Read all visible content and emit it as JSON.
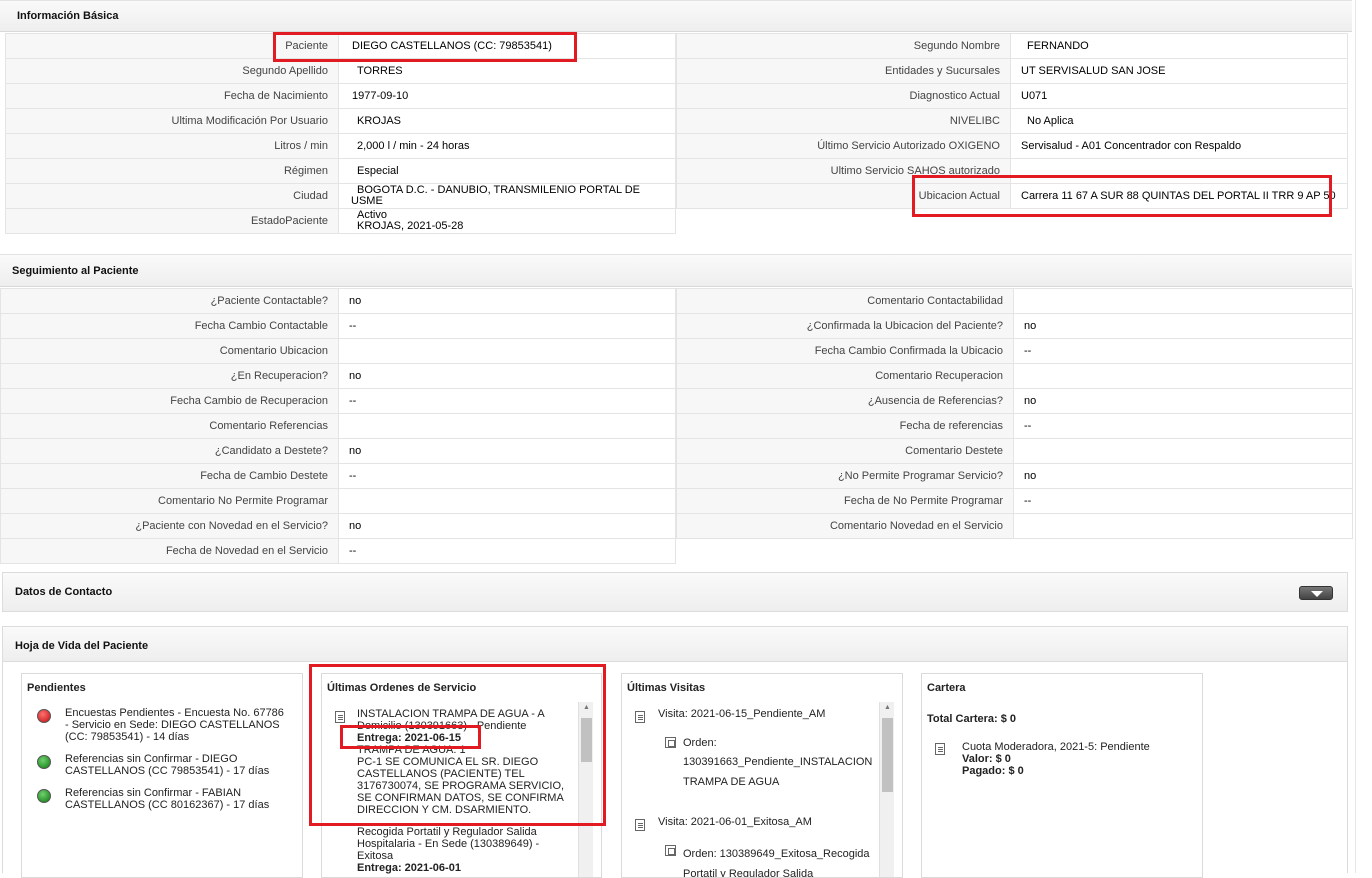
{
  "info": {
    "title": "Información Básica",
    "left": [
      {
        "label": "Paciente",
        "value": "DIEGO CASTELLANOS (CC: 79853541)"
      },
      {
        "label": "Segundo Apellido",
        "value": "TORRES"
      },
      {
        "label": "Fecha de Nacimiento",
        "value": "1977-09-10"
      },
      {
        "label": "Ultima Modificación Por Usuario",
        "value": "KROJAS"
      },
      {
        "label": "Litros / min",
        "value": "2,000 l / min - 24 horas"
      },
      {
        "label": "Régimen",
        "value": "Especial"
      },
      {
        "label": "Ciudad",
        "value": "BOGOTA D.C. - DANUBIO, TRANSMILENIO PORTAL DE USME"
      },
      {
        "label": "EstadoPaciente",
        "value": "Activo",
        "value2": "KROJAS, 2021-05-28"
      }
    ],
    "right": [
      {
        "label": "Segundo Nombre",
        "value": "FERNANDO"
      },
      {
        "label": "Entidades y Sucursales",
        "value": "UT SERVISALUD SAN JOSE"
      },
      {
        "label": "Diagnostico Actual",
        "value": "U071"
      },
      {
        "label": "NIVELIBC",
        "value": "No Aplica"
      },
      {
        "label": "Último Servicio Autorizado OXIGENO",
        "value": "Servisalud - A01 Concentrador con Respaldo"
      },
      {
        "label": "Ultimo Servicio SAHOS autorizado",
        "value": ""
      },
      {
        "label": "Ubicacion Actual",
        "value": "Carrera 11 67 A SUR 88 QUINTAS DEL PORTAL II TRR 9 AP 50"
      }
    ]
  },
  "seguimiento": {
    "title": "Seguimiento al Paciente",
    "left": [
      {
        "label": "¿Paciente Contactable?",
        "value": "no"
      },
      {
        "label": "Fecha Cambio Contactable",
        "value": "--"
      },
      {
        "label": "Comentario Ubicacion",
        "value": ""
      },
      {
        "label": "¿En Recuperacion?",
        "value": "no"
      },
      {
        "label": "Fecha Cambio de Recuperacion",
        "value": "--"
      },
      {
        "label": "Comentario Referencias",
        "value": ""
      },
      {
        "label": "¿Candidato a Destete?",
        "value": "no"
      },
      {
        "label": "Fecha de Cambio Destete",
        "value": "--"
      },
      {
        "label": "Comentario No Permite Programar",
        "value": ""
      },
      {
        "label": "¿Paciente con Novedad en el Servicio?",
        "value": "no"
      },
      {
        "label": "Fecha de Novedad en el Servicio",
        "value": "--"
      }
    ],
    "right": [
      {
        "label": "Comentario Contactabilidad",
        "value": ""
      },
      {
        "label": "¿Confirmada la Ubicacion del Paciente?",
        "value": "no"
      },
      {
        "label": "Fecha Cambio Confirmada la Ubicacio",
        "value": "--"
      },
      {
        "label": "Comentario Recuperacion",
        "value": ""
      },
      {
        "label": "¿Ausencia de Referencias?",
        "value": "no"
      },
      {
        "label": "Fecha de referencias",
        "value": "--"
      },
      {
        "label": "Comentario Destete",
        "value": ""
      },
      {
        "label": "¿No Permite Programar Servicio?",
        "value": "no"
      },
      {
        "label": "Fecha de No Permite Programar",
        "value": "--"
      },
      {
        "label": "Comentario Novedad en el Servicio",
        "value": ""
      }
    ]
  },
  "contacto": {
    "title": "Datos de Contacto",
    "toggle_icon": "chevron-down-icon"
  },
  "hoja": {
    "title": "Hoja de Vida del Paciente",
    "pendientes": {
      "title": "Pendientes",
      "items": [
        {
          "status": "red",
          "text": "Encuestas Pendientes - Encuesta No. 67786 - Servicio en Sede: DIEGO CASTELLANOS (CC: 79853541) - 14 días"
        },
        {
          "status": "green",
          "text": "Referencias sin Confirmar - DIEGO CASTELLANOS (CC 79853541) - 17 días"
        },
        {
          "status": "green",
          "text": "Referencias sin Confirmar - FABIAN CASTELLANOS (CC 80162367) - 17 días"
        }
      ]
    },
    "ordenes": {
      "title": "Últimas Ordenes de Servicio",
      "o1_title": "INSTALACION TRAMPA DE AGUA - A Domicilio (130391663) - Pendiente",
      "o1_entrega": "Entrega: 2021-06-15",
      "o1_line": "TRAMPA DE AGUA: 1",
      "o1_desc": "PC-1 SE COMUNICA EL SR. DIEGO CASTELLANOS (PACIENTE) TEL 3176730074, SE PROGRAMA SERVICIO, SE CONFIRMAN DATOS, SE CONFIRMA DIRECCION Y CM. DSARMIENTO.",
      "o2_title": "Recogida Portatil y Regulador Salida Hospitalaria - En Sede (130389649) - Exitosa",
      "o2_entrega": "Entrega: 2021-06-01"
    },
    "visitas": {
      "title": "Últimas Visitas",
      "v1": "Visita: 2021-06-15_Pendiente_AM",
      "v1_label": "Orden:",
      "v1_order": "130391663_Pendiente_INSTALACION TRAMPA DE AGUA",
      "v2": "Visita: 2021-06-01_Exitosa_AM",
      "v2_order": "Orden: 130389649_Exitosa_Recogida Portatil y Regulador Salida"
    },
    "cartera": {
      "title": "Cartera",
      "total": "Total Cartera: $ 0",
      "cuota": "Cuota Moderadora, 2021-5: Pendiente",
      "valor": "Valor: $ 0",
      "pagado": "Pagado: $ 0"
    }
  }
}
